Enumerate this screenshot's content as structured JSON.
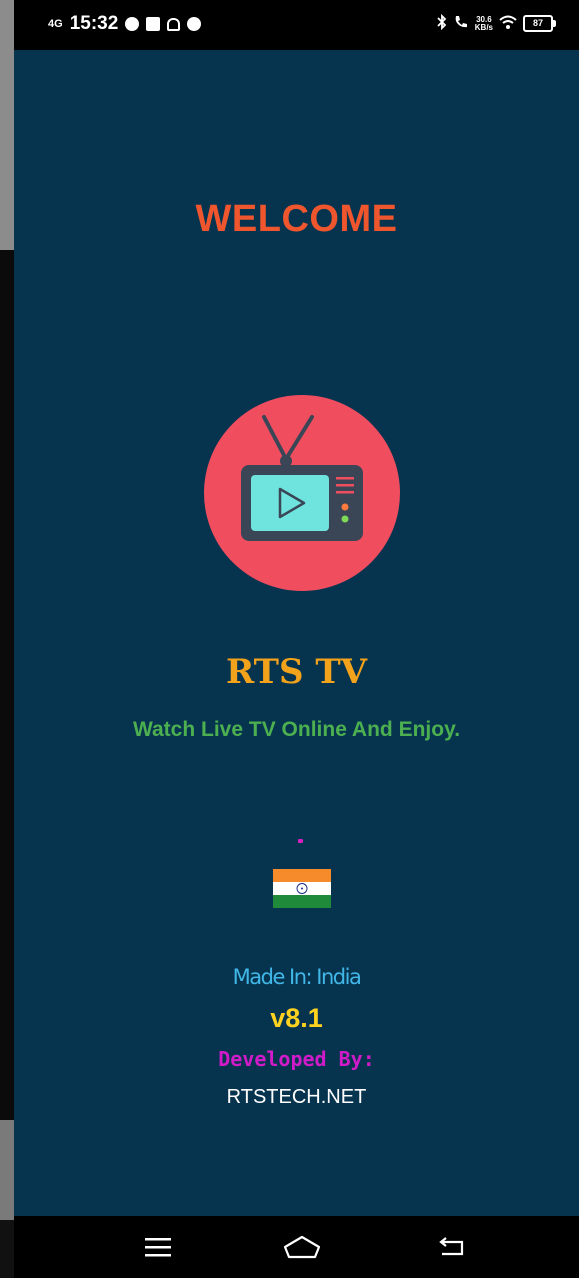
{
  "status_bar": {
    "network": "4G",
    "time": "15:32",
    "speed_value": "30.6",
    "speed_unit": "KB/s",
    "battery": "87",
    "icons": [
      "telegram-icon",
      "youtube-icon",
      "bell-icon",
      "vpn-icon",
      "bluetooth-icon",
      "call-icon",
      "wifi-icon",
      "battery-icon"
    ]
  },
  "splash": {
    "welcome": "WELCOME",
    "app_name": "RTS TV",
    "tagline": "Watch Live TV Online And Enjoy.",
    "made_in": "Made In: India",
    "version": "v8.1",
    "developed_by_label": "Developed By:",
    "developer": "RTSTECH.NET"
  },
  "logo": {
    "icon": "tv-play-icon",
    "circle_color": "#f04d5f",
    "screen_color": "#6fe3de",
    "body_color": "#3a4656"
  },
  "flag": {
    "icon": "india-flag-icon"
  },
  "nav_bar": {
    "icons": [
      "menu-icon",
      "home-icon",
      "back-icon"
    ]
  },
  "colors": {
    "background": "#06344f",
    "welcome": "#f0562e",
    "app_name": "#f2a21b",
    "tagline": "#4caf50",
    "made_in": "#41b7e8",
    "version": "#ffd21f",
    "developed_by": "#d11bc9",
    "developer": "#ffffff"
  }
}
